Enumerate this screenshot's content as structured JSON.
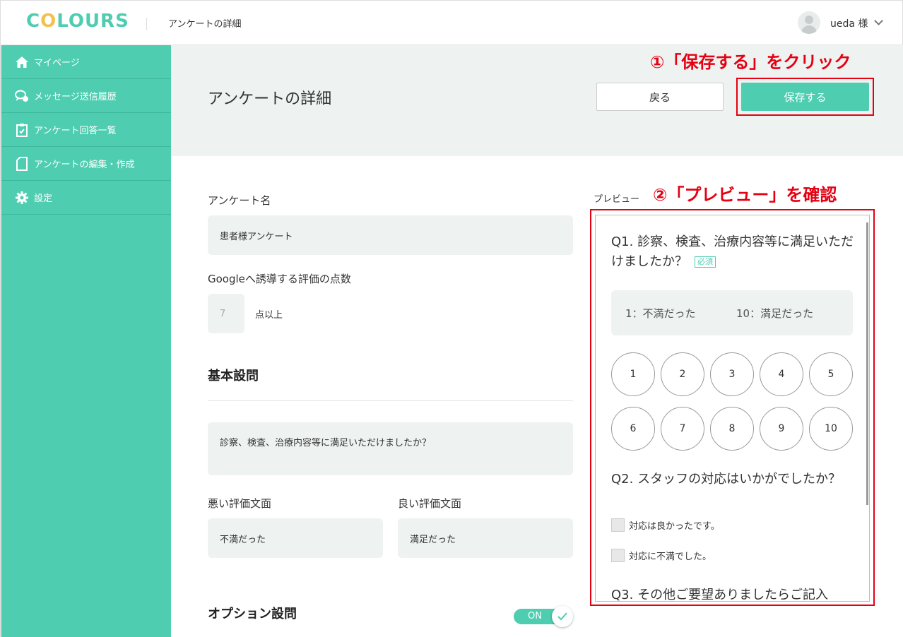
{
  "header": {
    "logo": "COLOURS",
    "page_title": "アンケートの詳細",
    "username": "ueda 様"
  },
  "sidebar": {
    "items": [
      {
        "label": "マイページ",
        "icon": "home-icon"
      },
      {
        "label": "メッセージ送信履歴",
        "icon": "chat-icon"
      },
      {
        "label": "アンケート回答一覧",
        "icon": "clipboard-icon"
      },
      {
        "label": "アンケートの編集・作成",
        "icon": "document-icon"
      },
      {
        "label": "設定",
        "icon": "gear-icon"
      }
    ]
  },
  "page": {
    "title": "アンケートの詳細",
    "back_label": "戻る",
    "save_label": "保存する"
  },
  "annotations": {
    "step1": "①「保存する」をクリック",
    "step2": "②「プレビュー」を確認"
  },
  "form": {
    "survey_name_label": "アンケート名",
    "survey_name_value": "患者様アンケート",
    "google_score_label": "Googleへ誘導する評価の点数",
    "google_score_placeholder": "7",
    "google_score_suffix": "点以上",
    "basic_section_title": "基本設問",
    "basic_question_value": "診察、検査、治療内容等に満足いただけましたか？",
    "bad_label": "悪い評価文面",
    "bad_value": "不満だった",
    "good_label": "良い評価文面",
    "good_value": "満足だった",
    "option_section_title": "オプション設問",
    "option_toggle_label": "ON"
  },
  "preview": {
    "label": "プレビュー",
    "q1_text": "Q1. 診察、検査、治療内容等に満足いただけましたか？",
    "required_badge": "必須",
    "scale_low": "1：不満だった",
    "scale_high": "10：満足だった",
    "scale_numbers": [
      "1",
      "2",
      "3",
      "4",
      "5",
      "6",
      "7",
      "8",
      "9",
      "10"
    ],
    "q2_text": "Q2. スタッフの対応はいかがでしたか？",
    "q2_options": [
      "対応は良かったです。",
      "対応に不満でした。"
    ],
    "q3_text": "Q3. その他ご要望ありましたらご記入"
  },
  "colors": {
    "accent": "#4ecdb0",
    "annotation_red": "#e50012",
    "field_bg": "#eef2f1"
  }
}
